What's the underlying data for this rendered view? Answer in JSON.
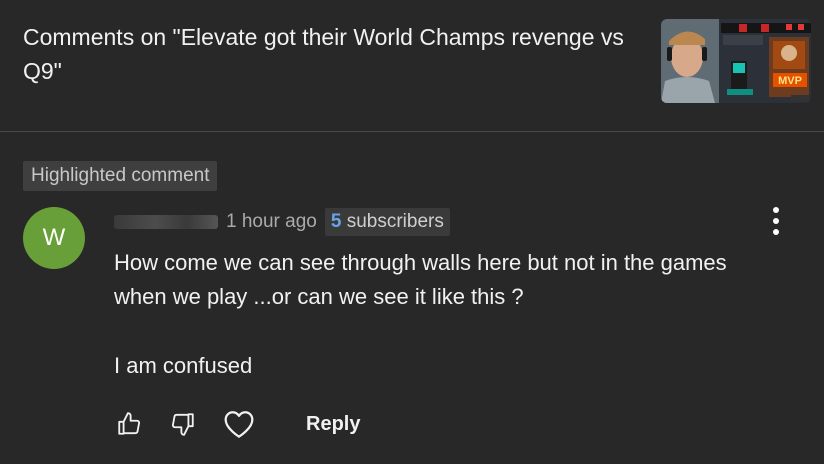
{
  "header": {
    "title": "Comments on \"Elevate got their World Champs revenge vs Q9\""
  },
  "thumbnail": {
    "overlay_text": "MVP"
  },
  "comment": {
    "highlight_label": "Highlighted comment",
    "avatar_letter": "W",
    "timestamp": "1 hour ago",
    "subscribers_count": "5",
    "subscribers_word": "subscribers",
    "line1": "How come we can see through walls here but not in the games",
    "line2": "when we play ...or can we see it like this ?",
    "line3": "I am confused"
  },
  "actions": {
    "reply_label": "Reply"
  },
  "icons": {
    "like": "thumbs-up-icon",
    "dislike": "thumbs-down-icon",
    "heart": "heart-icon",
    "more": "more-vertical-icon"
  }
}
